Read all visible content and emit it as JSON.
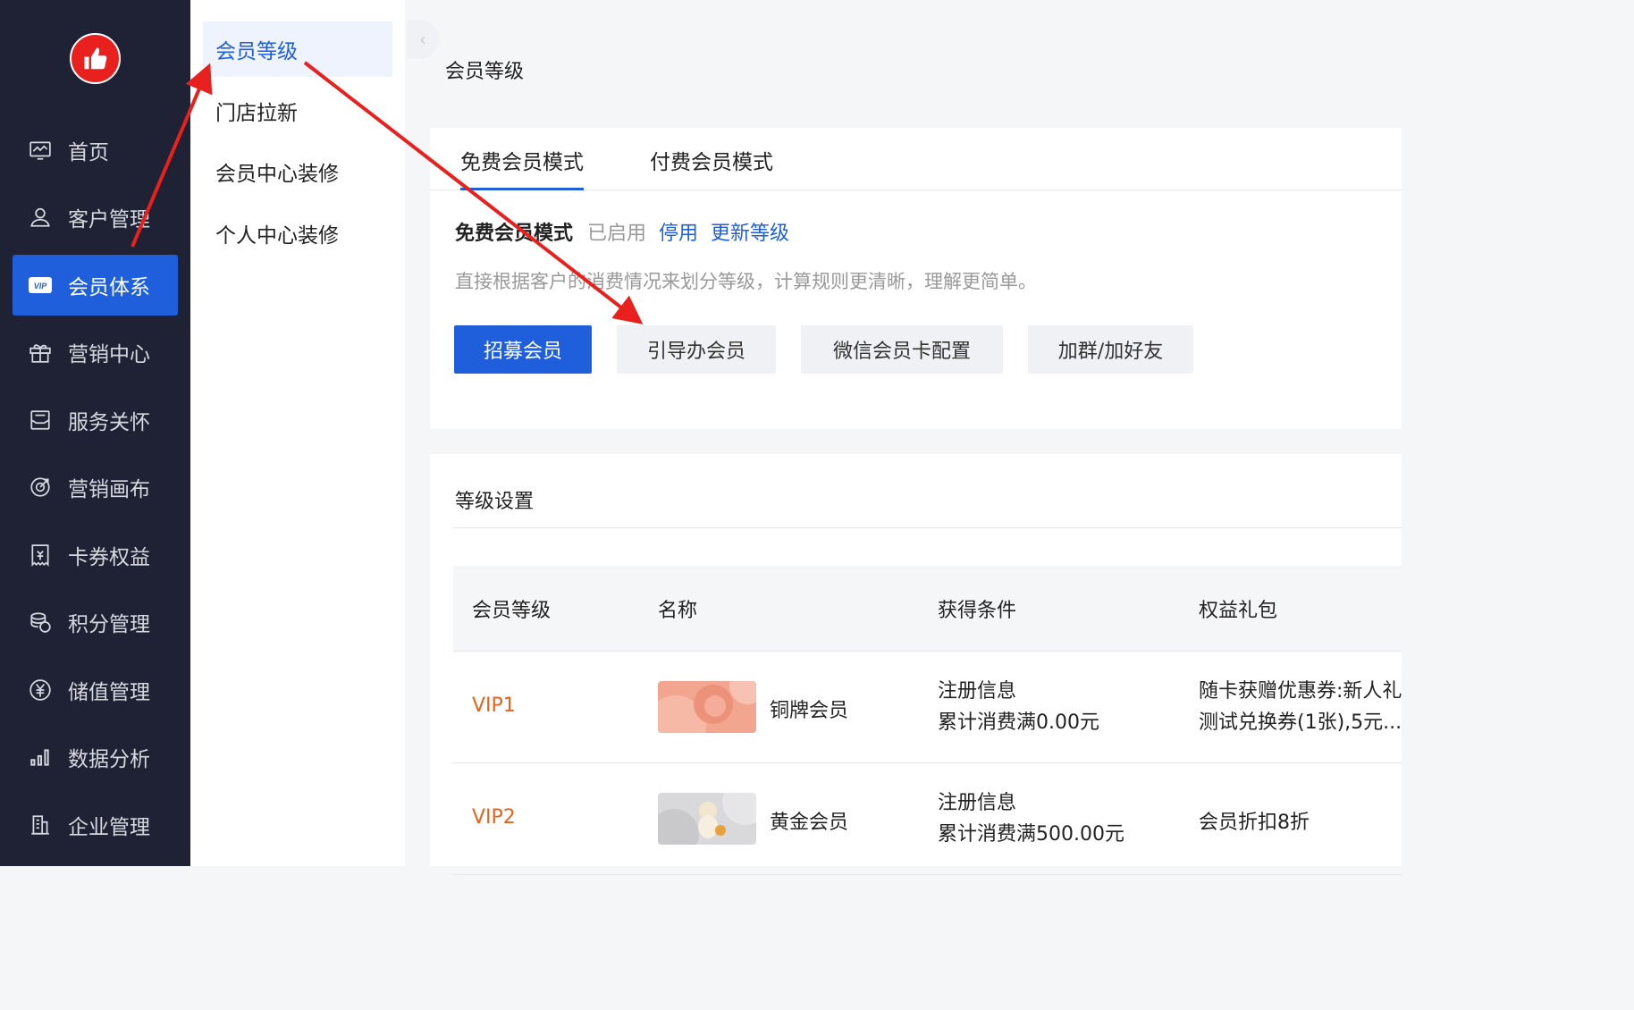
{
  "sidebar": {
    "items": [
      {
        "label": "首页",
        "icon": "dashboard-icon"
      },
      {
        "label": "客户管理",
        "icon": "user-icon"
      },
      {
        "label": "会员体系",
        "icon": "vip-icon",
        "active": true
      },
      {
        "label": "营销中心",
        "icon": "gift-icon"
      },
      {
        "label": "服务关怀",
        "icon": "message-icon"
      },
      {
        "label": "营销画布",
        "icon": "target-icon"
      },
      {
        "label": "卡券权益",
        "icon": "coupon-icon"
      },
      {
        "label": "积分管理",
        "icon": "coins-icon"
      },
      {
        "label": "储值管理",
        "icon": "yen-icon"
      },
      {
        "label": "数据分析",
        "icon": "bar-chart-icon"
      },
      {
        "label": "企业管理",
        "icon": "building-icon"
      }
    ],
    "vip_badge": "VIP"
  },
  "submenu": {
    "items": [
      {
        "label": "会员等级",
        "active": true
      },
      {
        "label": "门店拉新"
      },
      {
        "label": "会员中心装修"
      },
      {
        "label": "个人中心装修"
      }
    ]
  },
  "page": {
    "title": "会员等级",
    "collapse_glyph": "‹"
  },
  "tabs": [
    {
      "label": "免费会员模式",
      "active": true
    },
    {
      "label": "付费会员模式"
    }
  ],
  "mode": {
    "name": "免费会员模式",
    "status": "已启用",
    "disable_link": "停用",
    "update_link": "更新等级",
    "description": "直接根据客户的消费情况来划分等级，计算规则更清晰，理解更简单。"
  },
  "actions": {
    "recruit": "招募会员",
    "guide": "引导办会员",
    "wechat_card": "微信会员卡配置",
    "join_group": "加群/加好友"
  },
  "level_settings": {
    "title": "等级设置",
    "columns": [
      "会员等级",
      "名称",
      "获得条件",
      "权益礼包"
    ],
    "rows": [
      {
        "level": "VIP1",
        "name": "铜牌会员",
        "condition_1": "注册信息",
        "condition_2": "累计消费满0.00元",
        "benefit_1": "随卡获赠优惠券:新人礼",
        "benefit_2": "测试兑换券(1张),5元..."
      },
      {
        "level": "VIP2",
        "name": "黄金会员",
        "condition_1": "注册信息",
        "condition_2": "累计消费满500.00元",
        "benefit_1": "会员折扣8折",
        "benefit_2": ""
      }
    ]
  },
  "colors": {
    "sidebar_bg": "#1f2234",
    "accent": "#1f5fdc",
    "vip_text": "#e8621a",
    "annotation_arrow": "#e8201e"
  }
}
